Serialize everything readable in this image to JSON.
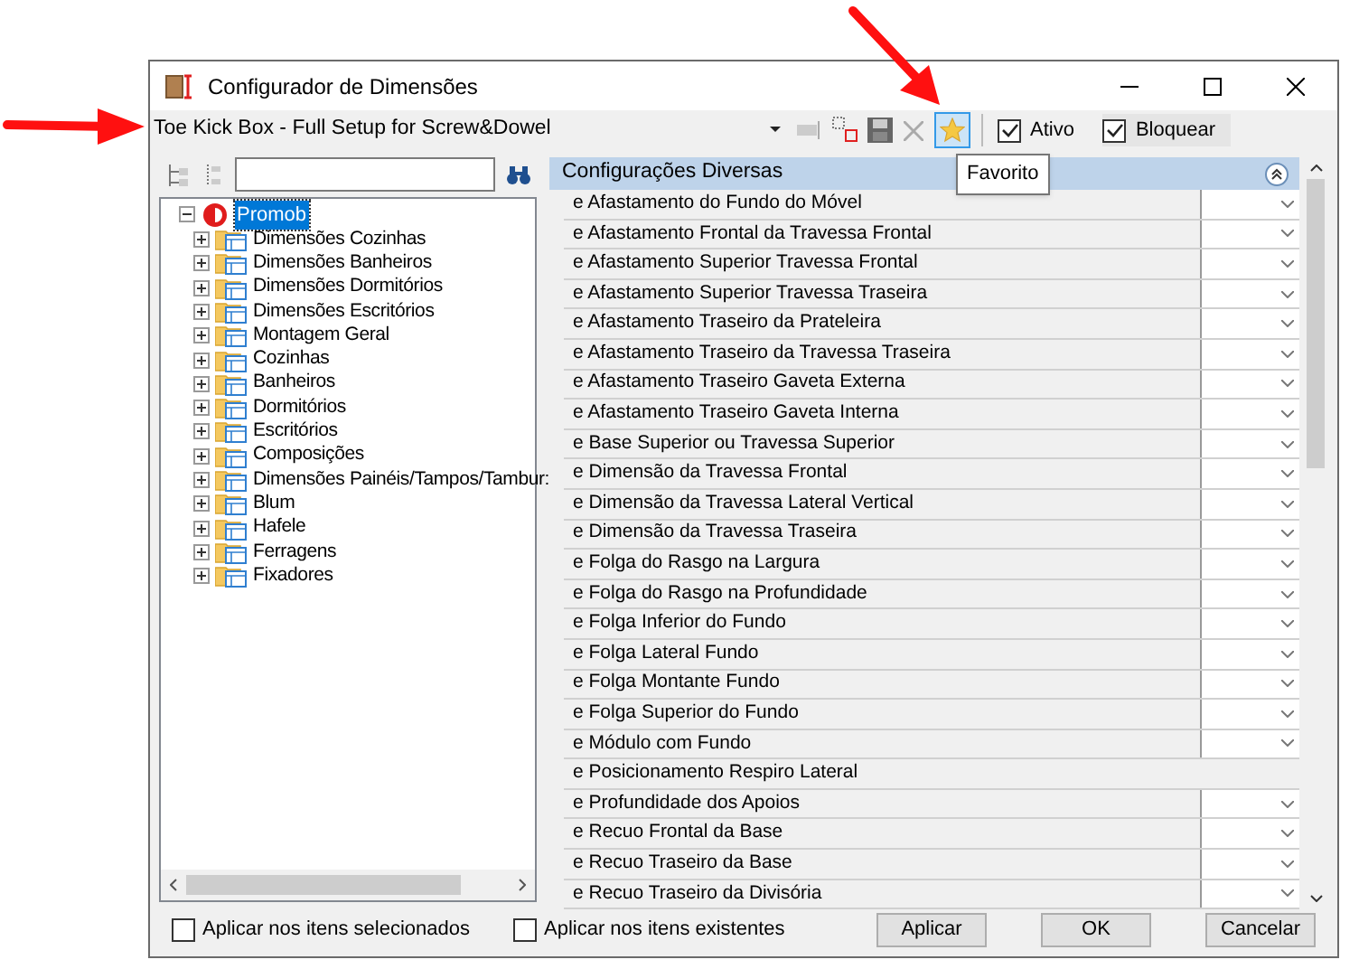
{
  "window": {
    "title": "Configurador de Dimensões"
  },
  "toolbar": {
    "combo_value": "Toe Kick Box - Full Setup for Screw&Dowel",
    "favorite_pressed": true,
    "tooltip": "Favorito",
    "checkboxes": [
      {
        "label": "Ativo",
        "checked": true
      },
      {
        "label": "Bloquear",
        "checked": true
      }
    ]
  },
  "tree": {
    "root": {
      "label": "Promob",
      "selected": true,
      "expanded": true,
      "children": [
        {
          "label": "Dimensões Cozinhas",
          "expanded": false
        },
        {
          "label": "Dimensões Banheiros",
          "expanded": false
        },
        {
          "label": "Dimensões Dormitórios",
          "expanded": false
        },
        {
          "label": "Dimensões Escritórios",
          "expanded": false
        },
        {
          "label": "Montagem Geral",
          "expanded": false
        },
        {
          "label": "Cozinhas",
          "expanded": false
        },
        {
          "label": "Banheiros",
          "expanded": false
        },
        {
          "label": "Dormitórios",
          "expanded": false
        },
        {
          "label": "Escritórios",
          "expanded": false
        },
        {
          "label": "Composições",
          "expanded": false
        },
        {
          "label": "Dimensões Painéis/Tampos/Tambur:",
          "expanded": false
        },
        {
          "label": "Blum",
          "expanded": false
        },
        {
          "label": "Hafele",
          "expanded": false
        },
        {
          "label": "Ferragens",
          "expanded": false
        },
        {
          "label": "Fixadores",
          "expanded": false
        }
      ]
    }
  },
  "properties": {
    "header": "Configurações Diversas",
    "rows": [
      {
        "label": "e Afastamento do Fundo do Móvel",
        "kind": "dropdown"
      },
      {
        "label": "e Afastamento Frontal da Travessa Frontal",
        "kind": "dropdown"
      },
      {
        "label": "e Afastamento Superior Travessa Frontal",
        "kind": "dropdown"
      },
      {
        "label": "e Afastamento Superior Travessa Traseira",
        "kind": "dropdown"
      },
      {
        "label": "e Afastamento Traseiro da Prateleira",
        "kind": "dropdown"
      },
      {
        "label": "e Afastamento Traseiro da Travessa Traseira",
        "kind": "dropdown"
      },
      {
        "label": "e Afastamento Traseiro Gaveta Externa",
        "kind": "dropdown"
      },
      {
        "label": "e Afastamento Traseiro Gaveta Interna",
        "kind": "dropdown"
      },
      {
        "label": "e Base Superior ou Travessa Superior",
        "kind": "dropdown"
      },
      {
        "label": "e Dimensão da Travessa Frontal",
        "kind": "dropdown"
      },
      {
        "label": "e Dimensão da Travessa Lateral Vertical",
        "kind": "dropdown"
      },
      {
        "label": "e Dimensão da Travessa Traseira",
        "kind": "dropdown"
      },
      {
        "label": "e Folga do Rasgo na Largura",
        "kind": "dropdown"
      },
      {
        "label": "e Folga do Rasgo na Profundidade",
        "kind": "dropdown"
      },
      {
        "label": "e Folga Inferior do Fundo",
        "kind": "dropdown"
      },
      {
        "label": "e Folga Lateral Fundo",
        "kind": "dropdown"
      },
      {
        "label": "e Folga Montante Fundo",
        "kind": "dropdown"
      },
      {
        "label": "e Folga Superior do Fundo",
        "kind": "dropdown"
      },
      {
        "label": "e Módulo com Fundo",
        "kind": "dropdown"
      },
      {
        "label": "e Posicionamento Respiro Lateral",
        "kind": "plain"
      },
      {
        "label": "e Profundidade dos Apoios",
        "kind": "dropdown"
      },
      {
        "label": "e Recuo Frontal da Base",
        "kind": "dropdown"
      },
      {
        "label": "e Recuo Traseiro da Base",
        "kind": "dropdown"
      },
      {
        "label": "e Recuo Traseiro da Divisória",
        "kind": "dropdown"
      }
    ]
  },
  "footer": {
    "checkboxes": [
      {
        "label": "Aplicar nos itens selecionados",
        "checked": false
      },
      {
        "label": "Aplicar nos itens existentes",
        "checked": false
      }
    ],
    "buttons": [
      "Aplicar",
      "OK",
      "Cancelar"
    ]
  }
}
